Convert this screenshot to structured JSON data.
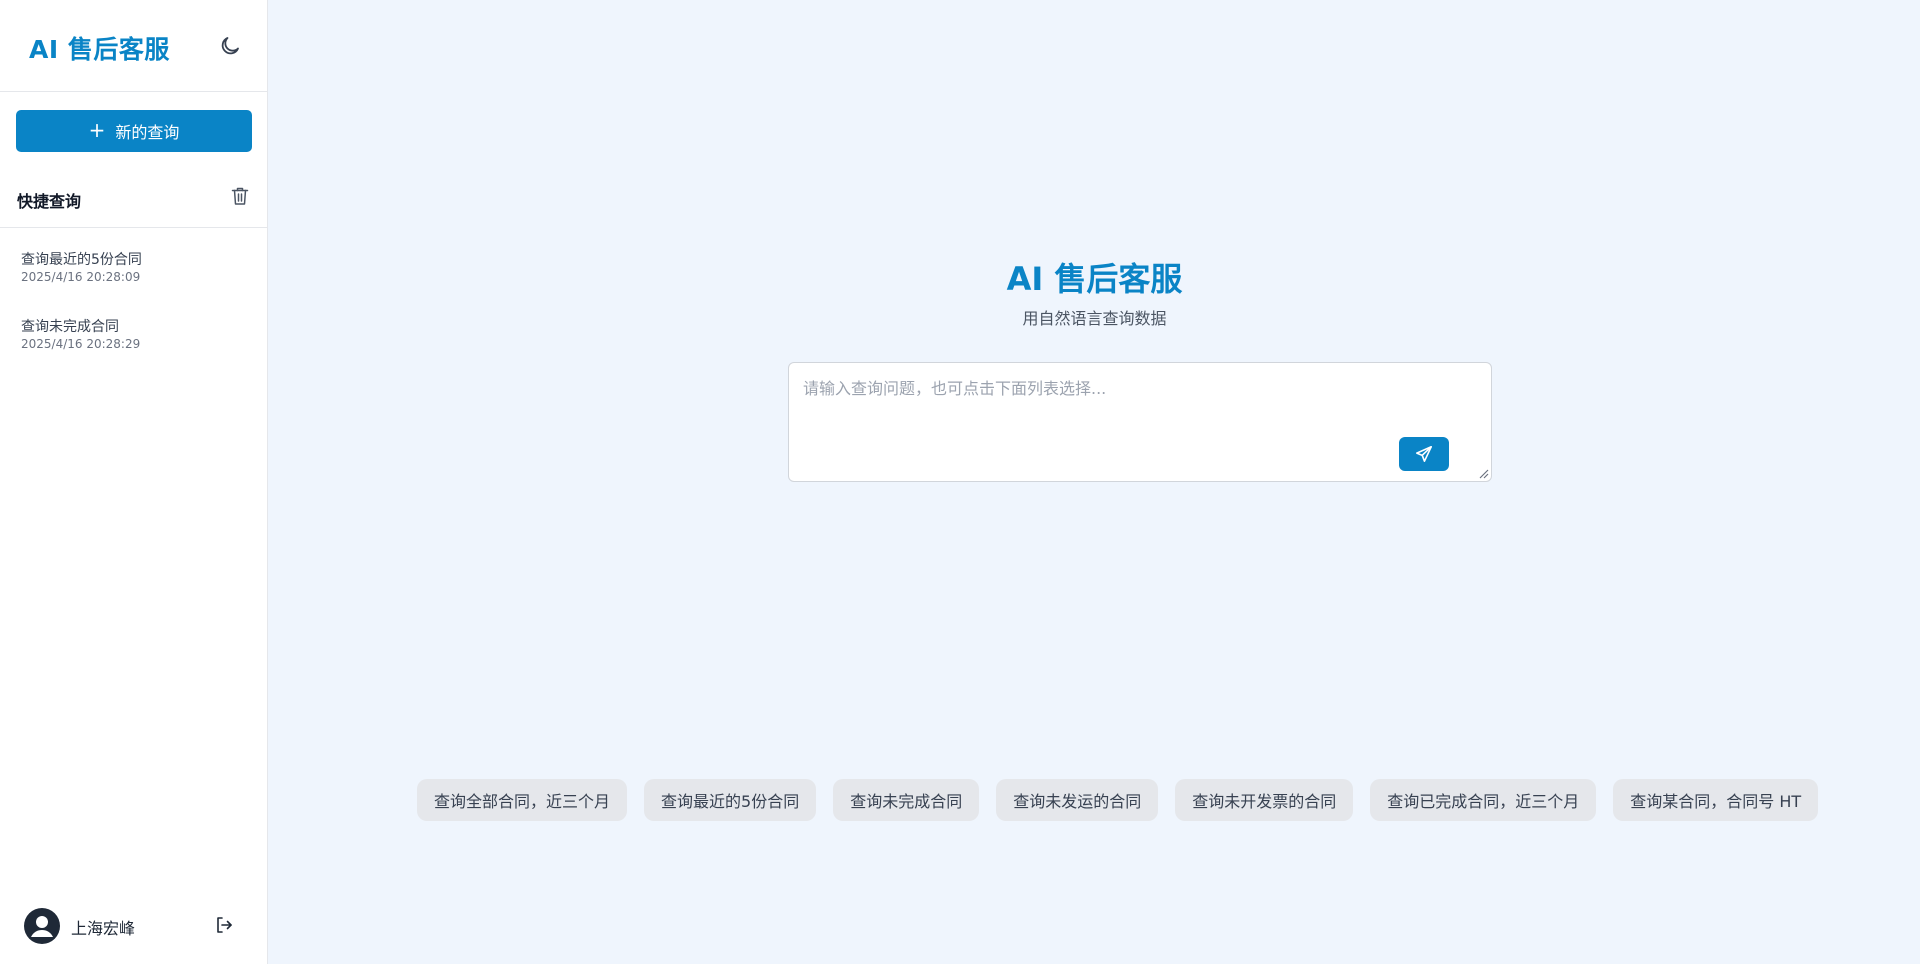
{
  "sidebar": {
    "brand": "AI 售后客服",
    "new_query_label": "新的查询",
    "quick_title": "快捷查询",
    "history": [
      {
        "title": "查询最近的5份合同",
        "time": "2025/4/16 20:28:09"
      },
      {
        "title": "查询未完成合同",
        "time": "2025/4/16 20:28:29"
      }
    ],
    "user_name": "上海宏峰"
  },
  "main": {
    "title": "AI 售后客服",
    "subtitle": "用自然语言查询数据",
    "input_placeholder": "请输入查询问题，也可点击下面列表选择...",
    "suggestions": [
      "查询全部合同，近三个月",
      "查询最近的5份合同",
      "查询未完成合同",
      "查询未发运的合同",
      "查询未开发票的合同",
      "查询已完成合同，近三个月",
      "查询某合同，合同号 HT"
    ]
  },
  "colors": {
    "accent": "#0a84c6",
    "background": "#eff5fd",
    "chip_bg": "#e5e7eb"
  },
  "icons": {
    "theme": "moon-icon",
    "add": "plus-icon",
    "clear": "trash-icon",
    "send": "paper-plane-icon",
    "user": "user-avatar-icon",
    "logout": "logout-icon"
  }
}
